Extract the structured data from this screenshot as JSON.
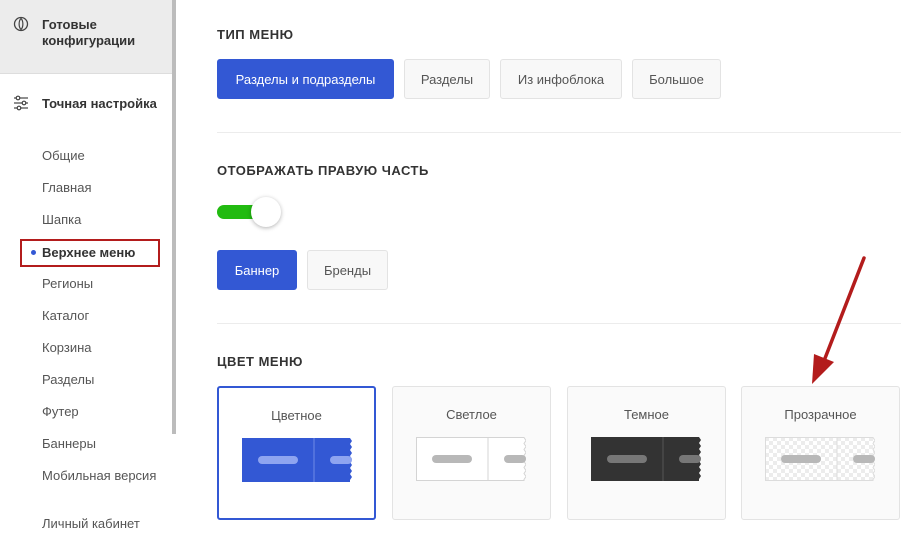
{
  "sidebar": {
    "ready_configs": {
      "label": "Готовые конфигурации",
      "icon": "configs-icon"
    },
    "fine_tuning": {
      "label": "Точная настройка",
      "icon": "sliders-icon"
    },
    "items": [
      {
        "label": "Общие"
      },
      {
        "label": "Главная"
      },
      {
        "label": "Шапка"
      },
      {
        "label": "Верхнее меню",
        "active": true
      },
      {
        "label": "Регионы"
      },
      {
        "label": "Каталог"
      },
      {
        "label": "Корзина"
      },
      {
        "label": "Разделы"
      },
      {
        "label": "Футер"
      },
      {
        "label": "Баннеры"
      },
      {
        "label": "Мобильная версия"
      },
      {
        "label": "Личный кабинет"
      }
    ]
  },
  "menu_type": {
    "title": "ТИП МЕНЮ",
    "options": [
      {
        "label": "Разделы и подразделы",
        "selected": true
      },
      {
        "label": "Разделы",
        "selected": false
      },
      {
        "label": "Из инфоблока",
        "selected": false
      },
      {
        "label": "Большое",
        "selected": false
      }
    ]
  },
  "right_part": {
    "title": "ОТОБРАЖАТЬ ПРАВУЮ ЧАСТЬ",
    "toggle_on": true,
    "options": [
      {
        "label": "Баннер",
        "selected": true
      },
      {
        "label": "Бренды",
        "selected": false
      }
    ]
  },
  "menu_color": {
    "title": "ЦВЕТ МЕНЮ",
    "options": [
      {
        "label": "Цветное",
        "selected": true,
        "fill": "#3358d4",
        "bar": "#8ea4f0"
      },
      {
        "label": "Светлое",
        "selected": false,
        "fill": "#ffffff",
        "bar": "#b8b8b8"
      },
      {
        "label": "Темное",
        "selected": false,
        "fill": "#333333",
        "bar": "#777777"
      },
      {
        "label": "Прозрачное",
        "selected": false,
        "fill": "transparent",
        "bar": "#b8b8b8"
      }
    ]
  },
  "colors": {
    "accent": "#3358d4",
    "toggle_on": "#22bb11",
    "highlight_border": "#b31c1c",
    "annotation_arrow": "#b31c1c"
  }
}
